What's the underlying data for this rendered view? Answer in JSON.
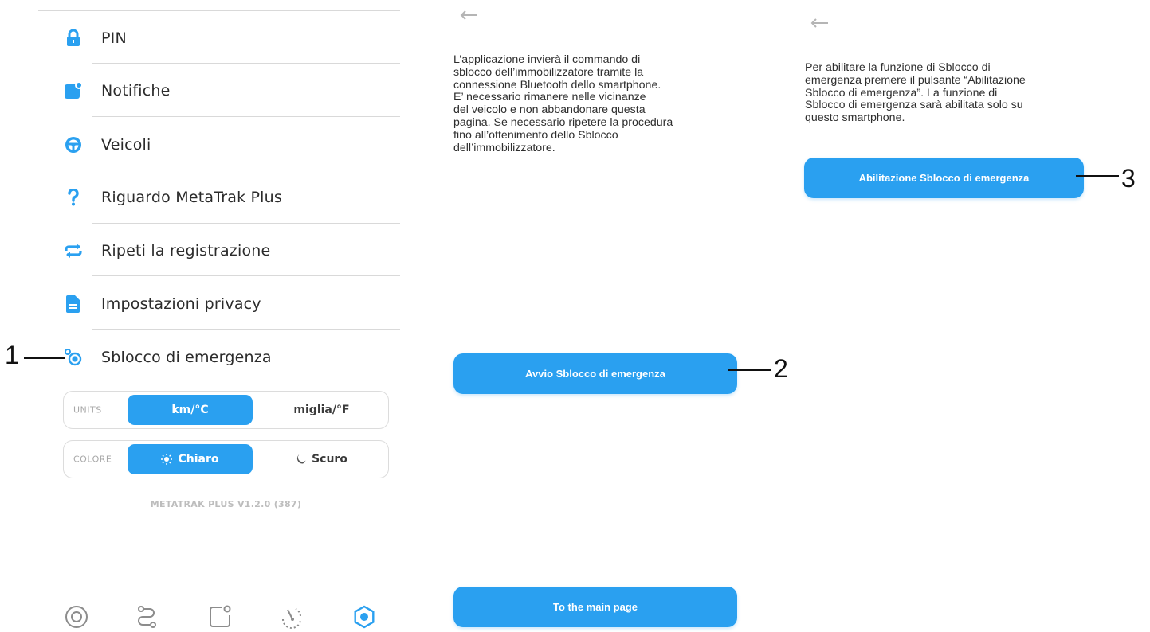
{
  "colors": {
    "accent": "#2aa0f0",
    "divider": "#d9d9d9",
    "text": "#2b2b2b"
  },
  "menu": {
    "items": [
      {
        "label": "PIN",
        "icon": "lock-icon"
      },
      {
        "label": "Notifiche",
        "icon": "notification-icon"
      },
      {
        "label": "Veicoli",
        "icon": "steering-wheel-icon"
      },
      {
        "label": "Riguardo MetaTrak Plus",
        "icon": "question-icon"
      },
      {
        "label": "Ripeti la registrazione",
        "icon": "repeat-icon"
      },
      {
        "label": "Impostazioni privacy",
        "icon": "document-icon"
      },
      {
        "label": "Sblocco di emergenza",
        "icon": "emergency-unlock-icon"
      }
    ]
  },
  "units": {
    "label": "UNITS",
    "option_a": "km/°C",
    "option_b": "miglia/°F",
    "selected": "km/°C"
  },
  "theme": {
    "label": "COLORE",
    "option_a": "Chiaro",
    "option_b": "Scuro",
    "selected": "Chiaro"
  },
  "version": "METATRAK PLUS V1.2.0 (387)",
  "tabbar": [
    "target-icon",
    "route-icon",
    "widget-icon",
    "speedometer-icon",
    "settings-icon"
  ],
  "middle": {
    "text": "L’applicazione invierà il commando di\nsblocco dell’immobilizzatore tramite la\nconnessione Bluetooth dello smartphone.\nE’ necessario rimanere nelle vicinanze\ndel veicolo e non abbandonare questa\npagina. Se necessario ripetere la procedura\nfino all’ottenimento dello Sblocco\ndell’immobilizzatore.",
    "start_button": "Avvio Sblocco di emergenza",
    "main_page_button": "To the main page"
  },
  "right": {
    "text": "Per abilitare la funzione di Sblocco di\nemergenza premere il pulsante “Abilitazione\nSblocco di emergenza”. La funzione di\nSblocco di emergenza sarà abilitata solo su\nquesto smartphone.",
    "enable_button": "Abilitazione Sblocco di emergenza"
  },
  "callouts": [
    "1",
    "2",
    "3"
  ]
}
